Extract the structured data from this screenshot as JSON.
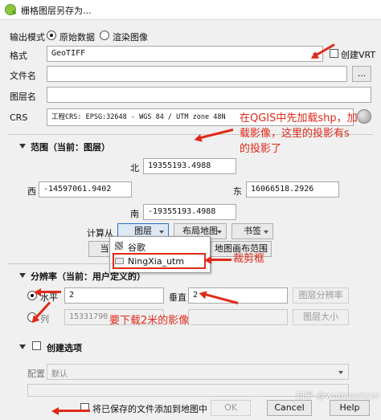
{
  "window": {
    "title": "栅格图层另存为..."
  },
  "output_mode": {
    "label": "输出模式",
    "options": [
      "原始数据",
      "渲染图像"
    ],
    "selected": "原始数据"
  },
  "format": {
    "label": "格式",
    "value": "GeoTIFF",
    "create_vrt_label": "创建VRT"
  },
  "filename": {
    "label": "文件名",
    "value": "",
    "browse_label": "..."
  },
  "layer_name": {
    "label": "图层名",
    "value": ""
  },
  "crs": {
    "label": "CRS",
    "value": "工程CRS: EPSG:32648 - WGS 84 / UTM zone 48N"
  },
  "extent": {
    "title": "范围（当前：图层）",
    "north_label": "北",
    "north": "19355193.4988",
    "west_label": "西",
    "west": "-14597061.9402",
    "east_label": "东",
    "east": "16066518.2926",
    "south_label": "南",
    "south": "-19355193.4988",
    "calc_from_label": "计算从",
    "buttons": [
      "图层",
      "布局地图",
      "书签"
    ],
    "hidden_buttons": [
      "当",
      "地图画布范围"
    ],
    "popup": {
      "items": [
        "谷歌",
        "NingXia_utm"
      ]
    }
  },
  "resolution": {
    "title": "分辨率（当前：用户定义的）",
    "horizontal_label": "水平",
    "horizontal_value": "2",
    "vertical_label": "垂直",
    "vertical_value": "2",
    "layer_resolution_btn": "图层分辨率",
    "column_label": "列",
    "column_value": "15331790",
    "layer_size_btn": "图层大小"
  },
  "create_options": {
    "title": "创建选项",
    "profile_label": "配置",
    "profile_value": "默认"
  },
  "bottom": {
    "add_to_map_label": "将已保存的文件添加到地图中",
    "ok": "OK",
    "cancel": "Cancel",
    "help": "Help"
  },
  "annotations": {
    "note1_lines": [
      "在QGIS中先加载shp，加",
      "载影像，这里的投影有s",
      "的投影了"
    ],
    "note2": "裁剪框",
    "note3": "要下载2米的影像"
  },
  "watermark": "知乎 @wudaoanyer",
  "colors": {
    "annotation": "#e0291a",
    "title_bg": "#ffffff",
    "dialog_bg": "#f0f0f0"
  }
}
